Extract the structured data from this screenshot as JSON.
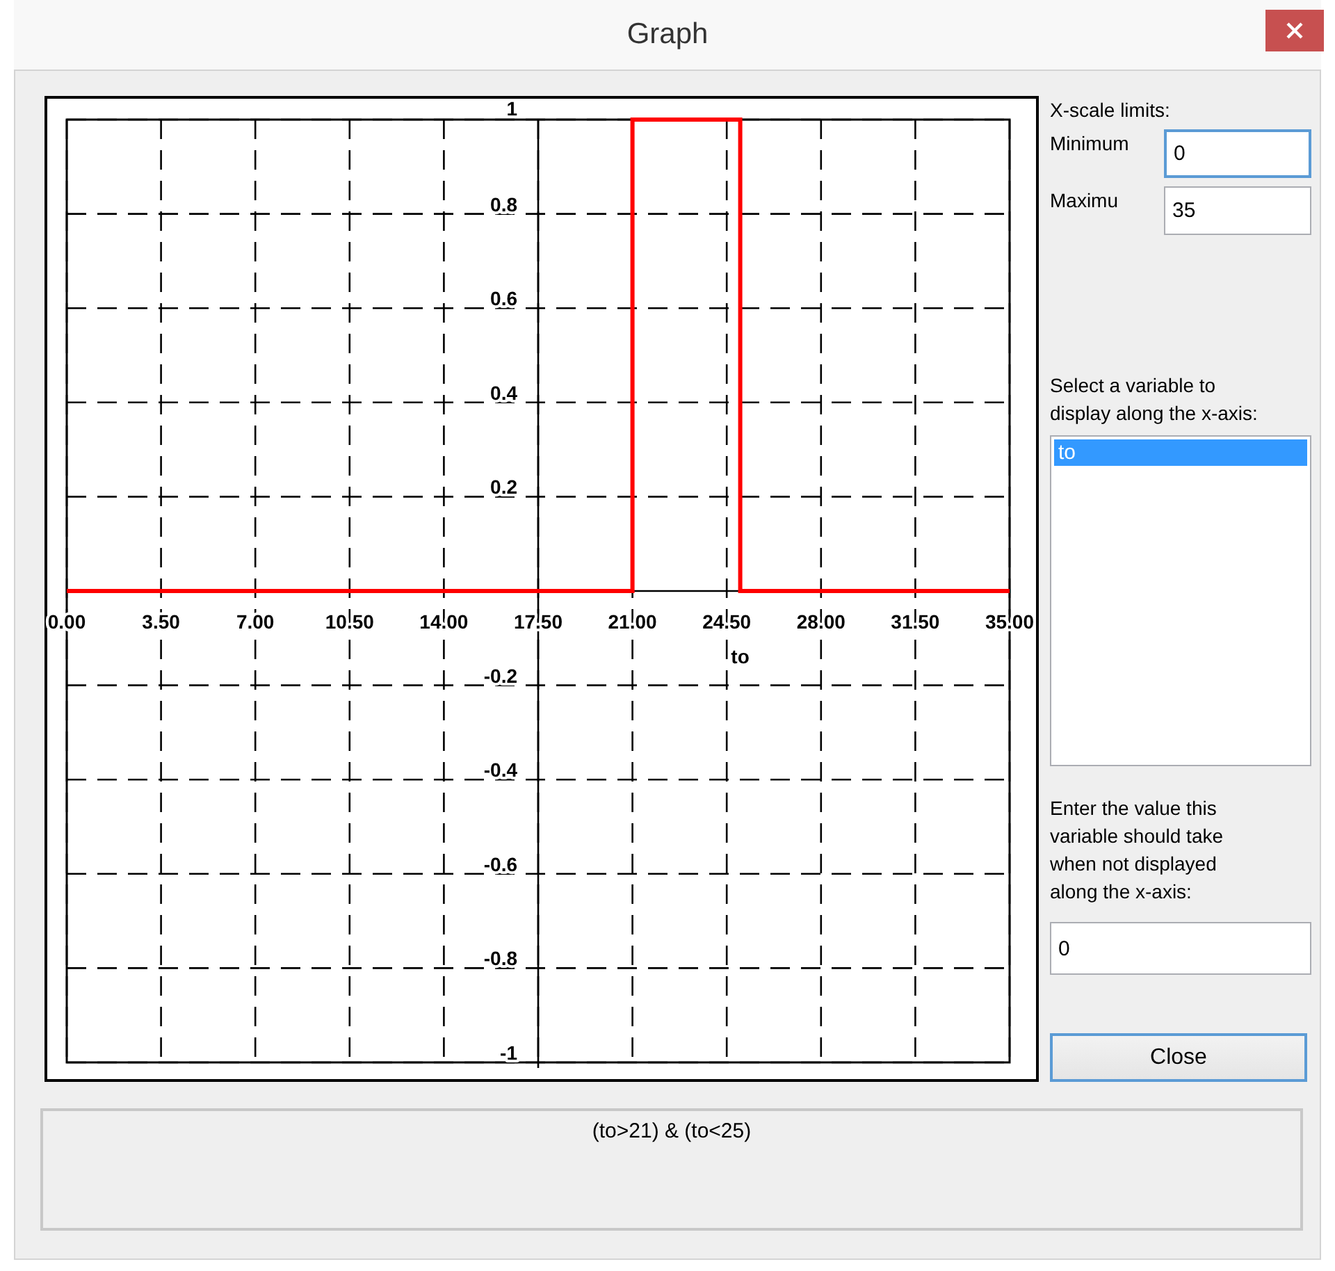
{
  "window": {
    "title": "Graph"
  },
  "chart": {
    "chart_data": {
      "type": "line",
      "grid": true,
      "xlabel": "to",
      "x": [
        0,
        21,
        21,
        25,
        25,
        35
      ],
      "xlim": [
        0,
        35
      ],
      "ylim": [
        -1,
        1
      ],
      "series": [
        {
          "color": "#ff0000",
          "values": [
            0,
            0,
            1,
            1,
            0,
            0
          ]
        }
      ],
      "xticks": [
        {
          "value": 0,
          "label": "0.00"
        },
        {
          "value": 3.5,
          "label": "3.50"
        },
        {
          "value": 7,
          "label": "7.00"
        },
        {
          "value": 10.5,
          "label": "10.50"
        },
        {
          "value": 14,
          "label": "14.00"
        },
        {
          "value": 17.5,
          "label": "17.50"
        },
        {
          "value": 21,
          "label": "21.00"
        },
        {
          "value": 24.5,
          "label": "24.50"
        },
        {
          "value": 28,
          "label": "28.00"
        },
        {
          "value": 31.5,
          "label": "31.50"
        },
        {
          "value": 35,
          "label": "35.00"
        }
      ],
      "yticks": [
        {
          "value": 1,
          "label": "1"
        },
        {
          "value": 0.8,
          "label": "0.8"
        },
        {
          "value": 0.6,
          "label": "0.6"
        },
        {
          "value": 0.4,
          "label": "0.4"
        },
        {
          "value": 0.2,
          "label": "0.2"
        },
        {
          "value": -0.2,
          "label": "-0.2"
        },
        {
          "value": -0.4,
          "label": "-0.4"
        },
        {
          "value": -0.6,
          "label": "-0.6"
        },
        {
          "value": -0.8,
          "label": "-0.8"
        },
        {
          "value": -1,
          "label": "-1"
        }
      ]
    }
  },
  "x_scale": {
    "label": "X-scale limits:",
    "fields": [
      {
        "label": "Minimum",
        "value": "0",
        "focused": true
      },
      {
        "label": "Maximu",
        "value": "35",
        "focused": false
      }
    ]
  },
  "variable_list": {
    "label": "Select a variable to display along the x-axis:",
    "items": [
      {
        "label": "to",
        "selected": true
      }
    ]
  },
  "fixed_value": {
    "label": "Enter the value this variable should take when not displayed along the x-axis:",
    "value": "0"
  },
  "close_button": {
    "label": "Close"
  },
  "formula": "(to>21) & (to<25)"
}
